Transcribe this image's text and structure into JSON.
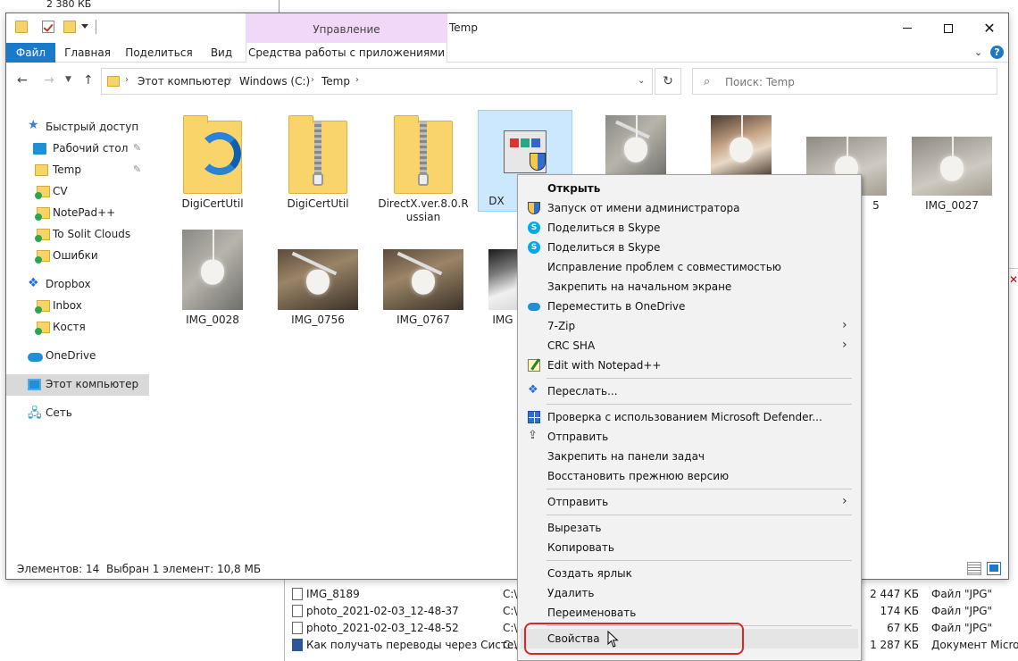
{
  "background": {
    "top_size": "2 380 КБ",
    "rows": [
      {
        "name": "IMG_8189",
        "path": "C:\\",
        "date": "",
        "size": "2 447 КБ",
        "type": "Файл \"JPG\""
      },
      {
        "name": "photo_2021-02-03_12-48-37",
        "path": "C:\\",
        "date": "",
        "size": "174 КБ",
        "type": "Файл \"JPG\""
      },
      {
        "name": "photo_2021-02-03_12-48-52",
        "path": "C:\\",
        "date": "",
        "size": "67 КБ",
        "type": "Файл \"JPG\""
      },
      {
        "name": "Как получать переводы через Систе...",
        "path": "C:\\",
        "date": "",
        "size": "1 287 КБ",
        "type": "Документ Micros..."
      }
    ]
  },
  "window": {
    "title": "Temp",
    "manage_tab": "Управление",
    "ribbon_tabs": {
      "file": "Файл",
      "home": "Главная",
      "share": "Поделиться",
      "view": "Вид",
      "tools": "Средства работы с приложениями"
    }
  },
  "address": {
    "crumbs": [
      "Этот компьютер",
      "Windows (C:)",
      "Temp"
    ],
    "search_placeholder": "Поиск: Temp"
  },
  "nav_pane": [
    {
      "label": "Быстрый доступ",
      "icon": "star-icon"
    },
    {
      "label": "Рабочий стол",
      "icon": "desktop-icon",
      "pinned": true
    },
    {
      "label": "Temp",
      "icon": "folder-icon",
      "pinned": true
    },
    {
      "label": "CV",
      "icon": "folder-synced-icon"
    },
    {
      "label": "NotePad++",
      "icon": "folder-synced-icon"
    },
    {
      "label": "To Solit Clouds",
      "icon": "folder-synced-icon"
    },
    {
      "label": "Ошибки",
      "icon": "folder-synced-icon"
    },
    {
      "label": "Dropbox",
      "icon": "dropbox-icon"
    },
    {
      "label": "Inbox",
      "icon": "folder-synced-icon"
    },
    {
      "label": "Костя",
      "icon": "folder-synced-icon"
    },
    {
      "label": "OneDrive",
      "icon": "onedrive-icon"
    },
    {
      "label": "Этот компьютер",
      "icon": "computer-icon",
      "selected": true
    },
    {
      "label": "Сеть",
      "icon": "network-icon"
    }
  ],
  "files": [
    {
      "name": "DigiCertUtil",
      "kind": "folder-app"
    },
    {
      "name": "DigiCertUtil",
      "kind": "zip"
    },
    {
      "name": "DirectX.ver.8.0.Russian",
      "kind": "zip"
    },
    {
      "name": "DX",
      "kind": "exe",
      "selected": true
    },
    {
      "name": "",
      "kind": "photo"
    },
    {
      "name": "",
      "kind": "photo"
    },
    {
      "name": "5",
      "kind": "photo"
    },
    {
      "name": "IMG_0027",
      "kind": "photo"
    },
    {
      "name": "IMG_0028",
      "kind": "photo"
    },
    {
      "name": "IMG_0756",
      "kind": "photo"
    },
    {
      "name": "IMG_0767",
      "kind": "photo"
    },
    {
      "name": "IMG",
      "kind": "photo"
    }
  ],
  "status": {
    "count": "Элементов: 14",
    "selected": "Выбран 1 элемент: 10,8 МБ"
  },
  "context_menu": {
    "open": "Открыть",
    "run_as_admin": "Запуск от имени администратора",
    "share_skype_1": "Поделиться в Skype",
    "share_skype_2": "Поделиться в Skype",
    "compat": "Исправление проблем с совместимостью",
    "pin_start": "Закрепить на начальном экране",
    "move_onedrive": "Переместить в OneDrive",
    "seven_zip": "7-Zip",
    "crc_sha": "CRC SHA",
    "notepadpp": "Edit with Notepad++",
    "forward": "Переслать...",
    "defender": "Проверка с использованием Microsoft Defender...",
    "share": "Отправить",
    "pin_taskbar": "Закрепить на панели задач",
    "restore": "Восстановить прежнюю версию",
    "send_to": "Отправить",
    "cut": "Вырезать",
    "copy": "Копировать",
    "shortcut": "Создать ярлык",
    "delete": "Удалить",
    "rename": "Переименовать",
    "properties": "Свойства"
  },
  "colors": {
    "accent": "#1979ca",
    "manage_tab": "#f1d8f9",
    "selection": "#cce8ff",
    "highlight_ring": "#d22a2a"
  }
}
